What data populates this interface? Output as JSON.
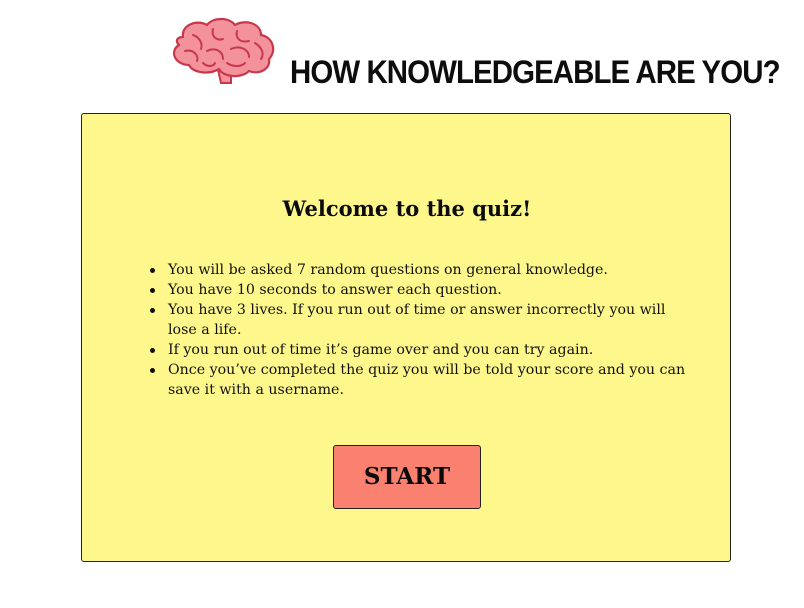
{
  "header": {
    "title": "How knowledgeable are you?",
    "logo_icon": "brain-icon"
  },
  "quiz_card": {
    "heading": "Welcome to the quiz!",
    "rules": [
      "You will be asked 7 random questions on general knowledge.",
      "You have 10 seconds to answer each question.",
      "You have 3 lives. If you run out of time or answer incorrectly you will lose a life.",
      "If you run out of time it’s game over and you can try again.",
      "Once you’ve completed the quiz you will be told your score and you can save it with a username."
    ],
    "start_label": "START"
  },
  "colors": {
    "card_background": "#fef88c",
    "button_background": "#fa8070",
    "brain_pink": "#f4929b",
    "brain_outline": "#c7384d"
  }
}
